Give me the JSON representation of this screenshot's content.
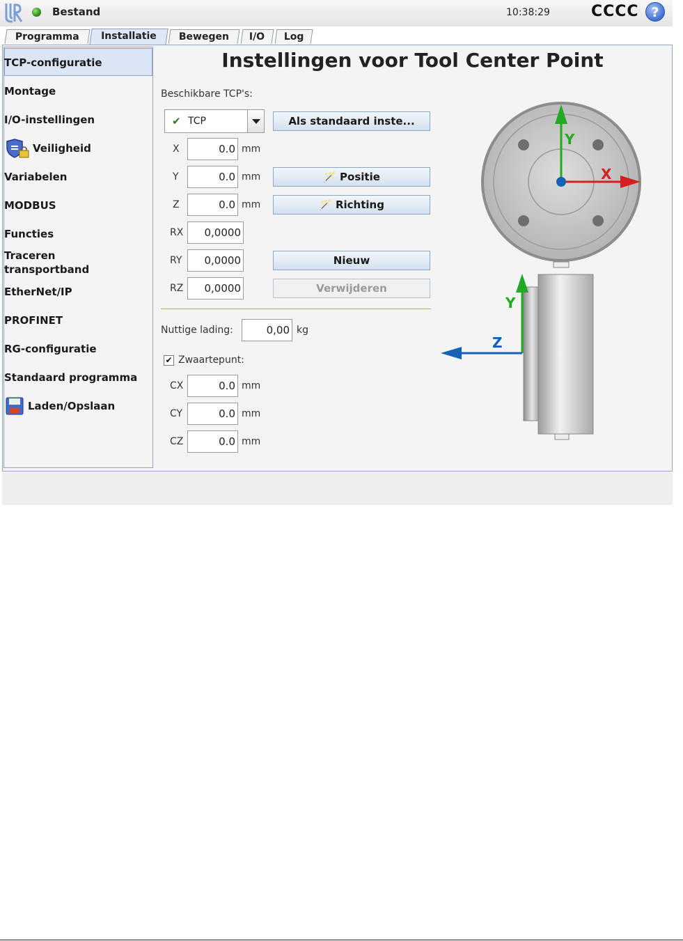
{
  "titlebar": {
    "app_title": "Bestand",
    "clock": "10:38:29",
    "robot_name": "CCCC",
    "help_label": "?"
  },
  "tabs": [
    {
      "label": "Programma"
    },
    {
      "label": "Installatie"
    },
    {
      "label": "Bewegen"
    },
    {
      "label": "I/O"
    },
    {
      "label": "Log"
    }
  ],
  "active_tab": "Installatie",
  "sidebar": {
    "items": [
      {
        "label": "TCP-configuratie"
      },
      {
        "label": "Montage"
      },
      {
        "label": "I/O-instellingen"
      },
      {
        "label": "Veiligheid"
      },
      {
        "label": "Variabelen"
      },
      {
        "label": "MODBUS"
      },
      {
        "label": "Functies"
      },
      {
        "label": "Traceren transportband"
      },
      {
        "label": "EtherNet/IP"
      },
      {
        "label": "PROFINET"
      },
      {
        "label": "RG-configuratie"
      },
      {
        "label": "Standaard programma"
      },
      {
        "label": "Laden/Opslaan"
      }
    ],
    "selected": "TCP-configuratie"
  },
  "main": {
    "title": "Instellingen voor Tool Center Point",
    "available_label": "Beschikbare TCP's:",
    "tcp_selected": "TCP",
    "set_default_button": "Als standaard inste...",
    "position_button": "Positie",
    "orientation_button": "Richting",
    "new_button": "Nieuw",
    "delete_button": "Verwijderen",
    "coords": [
      {
        "label": "X",
        "value": "0.0",
        "unit": "mm"
      },
      {
        "label": "Y",
        "value": "0.0",
        "unit": "mm"
      },
      {
        "label": "Z",
        "value": "0.0",
        "unit": "mm"
      },
      {
        "label": "RX",
        "value": "0,0000"
      },
      {
        "label": "RY",
        "value": "0,0000"
      },
      {
        "label": "RZ",
        "value": "0,0000"
      }
    ],
    "payload_label": "Nuttige lading:",
    "payload_value": "0,00",
    "payload_unit": "kg",
    "cog_checked": true,
    "cog_label": "Zwaartepunt:",
    "cog": [
      {
        "label": "CX",
        "value": "0.0",
        "unit": "mm"
      },
      {
        "label": "CY",
        "value": "0.0",
        "unit": "mm"
      },
      {
        "label": "CZ",
        "value": "0.0",
        "unit": "mm"
      }
    ]
  },
  "diagram": {
    "top_axes": {
      "x": "X",
      "y": "Y"
    },
    "side_axes": {
      "y": "Y",
      "z": "Z"
    },
    "colors": {
      "x_axis": "#d42020",
      "y_axis": "#22aa22",
      "z_axis": "#1560b8",
      "origin": "#1560b8"
    }
  },
  "icons": {
    "logo": "ur-logo-icon",
    "status": "status-dot-icon",
    "help": "help-icon",
    "safety": "shield-lock-icon",
    "save": "floppy-disk-icon",
    "tcp_check": "checkmark-icon",
    "dropdown": "chevron-down-icon",
    "teach": "wand-icon"
  }
}
